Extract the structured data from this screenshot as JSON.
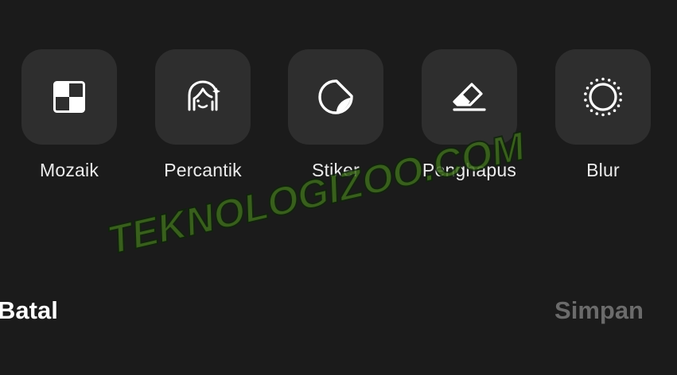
{
  "tools": [
    {
      "label": "Mozaik",
      "icon": "mosaic-icon"
    },
    {
      "label": "Percantik",
      "icon": "face-beautify-icon"
    },
    {
      "label": "Stiker",
      "icon": "sticker-icon"
    },
    {
      "label": "Penghapus",
      "icon": "eraser-icon"
    },
    {
      "label": "Blur",
      "icon": "blur-icon"
    }
  ],
  "actions": {
    "cancel_label": "Batal",
    "save_label": "Simpan"
  },
  "watermark": {
    "text": "TEKNOLOGIZOO.COM"
  },
  "colors": {
    "background": "#1b1b1b",
    "tile": "#2e2e2e",
    "label": "#ececec",
    "save_disabled": "#6b6b6b",
    "watermark": "#3f6b1e"
  }
}
